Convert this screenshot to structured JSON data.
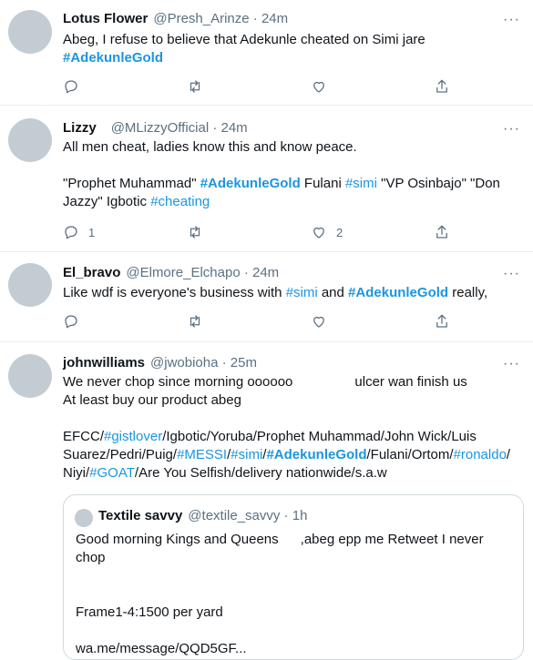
{
  "tweets": [
    {
      "name": "Lotus Flower",
      "meta": "@Presh_Arinze · 24m",
      "text_line1": "Abeg, I refuse to believe that Adekunle cheated on Simi jare",
      "hashtag1": "#AdekunleGold",
      "reply_count": "",
      "like_count": ""
    },
    {
      "name": "Lizzy",
      "meta": "@MLizzyOfficial · 24m",
      "text_line1": "All men cheat, ladies know this and know peace.",
      "p2_a": "\"Prophet Muhammad\" ",
      "p2_hash1": "#AdekunleGold",
      "p2_b": " Fulani ",
      "p2_hash2": "#simi",
      "p2_c": " \"VP Osinbajo\" \"Don",
      "p2_d": "Jazzy\" Igbotic ",
      "p2_hash3": "#cheating",
      "reply_count": "1",
      "like_count": "2"
    },
    {
      "name": "El_bravo",
      "meta": "@Elmore_Elchapo · 24m",
      "t_a": "Like wdf is everyone's business with ",
      "t_hash1": "#simi",
      "t_b": " and ",
      "t_hash2": "#AdekunleGold",
      "t_c": "  really,",
      "reply_count": "",
      "like_count": ""
    },
    {
      "name": "johnwilliams",
      "meta": "@jwobioha · 25m",
      "line1a": "We never chop since morning oooooo",
      "line1b": "ulcer wan finish us",
      "line2": "At least buy our product abeg",
      "l3a": "EFCC/",
      "l3h1": "#gistlover",
      "l3b": "/Igbotic/Yoruba/Prophet Muhammad/John Wick/Luis",
      "l4a": "Suarez/Pedri/Puig/",
      "l4h1": "#MESSI",
      "l4b": "/",
      "l4h2": "#simi",
      "l4c": "/",
      "l4h3": "#AdekunleGold",
      "l4d": "/Fulani/Ortom/",
      "l4h4": "#ronaldo",
      "l4e": "/",
      "l5a": "Niyi/",
      "l5h1": "#GOAT",
      "l5b": "/Are You Selfish/delivery nationwide/s.a.w",
      "quote": {
        "name": "Textile savvy",
        "meta": "@textile_savvy · 1h",
        "line1a": "Good morning Kings and Queens",
        "line1b": ",abeg epp me Retweet I never chop",
        "line2": "Frame1-4:1500 per yard",
        "line3": "wa.me/message/QQD5GF..."
      }
    }
  ],
  "more_icon": "more-horizontal-icon",
  "action_icons": [
    "reply-icon",
    "retweet-icon",
    "like-icon",
    "share-icon"
  ],
  "colors": {
    "link": "#1b95e0",
    "secondary": "#5b7083",
    "separator": "#e6ecf0"
  }
}
